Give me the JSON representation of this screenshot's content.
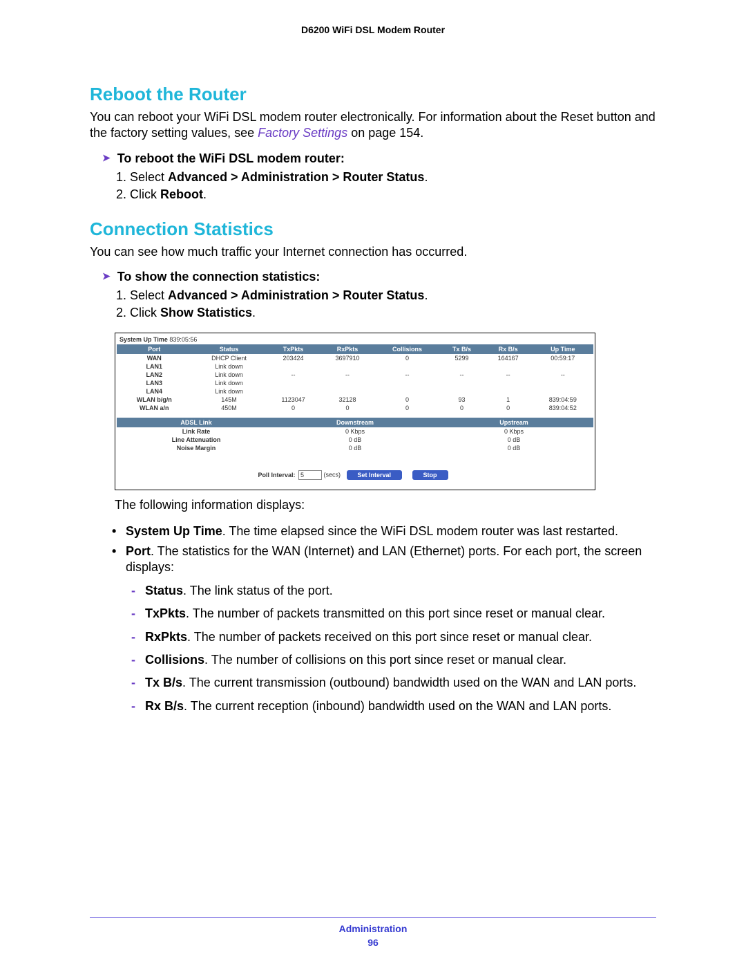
{
  "header": {
    "product": "D6200 WiFi DSL Modem Router"
  },
  "section1": {
    "title": "Reboot the Router",
    "intro_a": "You can reboot your WiFi DSL modem router electronically. For information about the Reset button and the factory setting values, see ",
    "crossref": "Factory Settings",
    "intro_b": " on page 154.",
    "proc_title": "To reboot the WiFi DSL modem router:",
    "step1_a": "Select ",
    "step1_b": "Advanced > Administration > Router Status",
    "step1_c": ".",
    "step2_a": "Click ",
    "step2_b": "Reboot",
    "step2_c": "."
  },
  "section2": {
    "title": "Connection Statistics",
    "intro": "You can see how much traffic your Internet connection has occurred.",
    "proc_title": "To show the connection statistics:",
    "step1_a": "Select ",
    "step1_b": "Advanced > Administration > Router Status",
    "step1_c": ".",
    "step2_a": "Click ",
    "step2_b": "Show Statistics",
    "step2_c": "."
  },
  "stats": {
    "uptime_label": "System Up Time ",
    "uptime_value": "839:05:56",
    "headers": {
      "port": "Port",
      "status": "Status",
      "tx": "TxPkts",
      "rx": "RxPkts",
      "coll": "Collisions",
      "txbs": "Tx B/s",
      "rxbs": "Rx B/s",
      "up": "Up Time"
    },
    "rows": [
      {
        "port": "WAN",
        "status": "DHCP Client",
        "tx": "203424",
        "rx": "3697910",
        "coll": "0",
        "txbs": "5299",
        "rxbs": "164167",
        "up": "00:59:17"
      },
      {
        "port": "LAN1",
        "status": "Link down",
        "tx": "",
        "rx": "",
        "coll": "",
        "txbs": "",
        "rxbs": "",
        "up": ""
      },
      {
        "port": "LAN2",
        "status": "Link down",
        "tx": "--",
        "rx": "--",
        "coll": "--",
        "txbs": "--",
        "rxbs": "--",
        "up": "--"
      },
      {
        "port": "LAN3",
        "status": "Link down",
        "tx": "",
        "rx": "",
        "coll": "",
        "txbs": "",
        "rxbs": "",
        "up": ""
      },
      {
        "port": "LAN4",
        "status": "Link down",
        "tx": "",
        "rx": "",
        "coll": "",
        "txbs": "",
        "rxbs": "",
        "up": ""
      },
      {
        "port": "WLAN b/g/n",
        "status": "145M",
        "tx": "1123047",
        "rx": "32128",
        "coll": "0",
        "txbs": "93",
        "rxbs": "1",
        "up": "839:04:59"
      },
      {
        "port": "WLAN a/n",
        "status": "450M",
        "tx": "0",
        "rx": "0",
        "coll": "0",
        "txbs": "0",
        "rxbs": "0",
        "up": "839:04:52"
      }
    ],
    "adsl_headers": {
      "link": "ADSL Link",
      "down": "Downstream",
      "up": "Upstream"
    },
    "adsl_rows": [
      {
        "label": "Link Rate",
        "down": "0 Kbps",
        "up": "0 Kbps"
      },
      {
        "label": "Line Attenuation",
        "down": "0 dB",
        "up": "0 dB"
      },
      {
        "label": "Noise Margin",
        "down": "0 dB",
        "up": "0 dB"
      }
    ],
    "poll_label": "Poll Interval:",
    "poll_value": "5",
    "poll_unit": "(secs)",
    "btn_set": "Set Interval",
    "btn_stop": "Stop"
  },
  "defs": {
    "intro": "The following information displays:",
    "sys_up_b": "System Up Time",
    "sys_up_t": ". The time elapsed since the WiFi DSL modem router was last restarted.",
    "port_b": "Port",
    "port_t": ". The statistics for the WAN (Internet) and LAN (Ethernet) ports. For each port, the screen displays:",
    "status_b": "Status",
    "status_t": ". The link status of the port.",
    "txpkts_b": "TxPkts",
    "txpkts_t": ". The number of packets transmitted on this port since reset or manual clear.",
    "rxpkts_b": "RxPkts",
    "rxpkts_t": ". The number of packets received on this port since reset or manual clear.",
    "coll_b": "Collisions",
    "coll_t": ". The number of collisions on this port since reset or manual clear.",
    "txbs_b": "Tx B/s",
    "txbs_t": ". The current transmission (outbound) bandwidth used on the WAN and LAN ports.",
    "rxbs_b": "Rx B/s",
    "rxbs_t": ". The current reception (inbound) bandwidth used on the WAN and LAN ports."
  },
  "footer": {
    "section": "Administration",
    "page": "96"
  }
}
